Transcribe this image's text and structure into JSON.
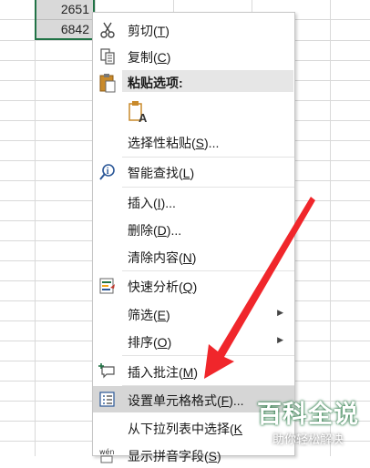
{
  "sheet": {
    "selected_cells": [
      "2651",
      "6842"
    ]
  },
  "menu": {
    "cut": {
      "text": "剪切(",
      "key": "T",
      "end": ")"
    },
    "copy": {
      "text": "复制(",
      "key": "C",
      "end": ")"
    },
    "paste_options_header": "粘贴选项:",
    "paste_special": {
      "text": "选择性粘贴(",
      "key": "S",
      "end": ")..."
    },
    "smart_lookup": {
      "text": "智能查找(",
      "key": "L",
      "end": ")"
    },
    "insert": {
      "text": "插入(",
      "key": "I",
      "end": ")..."
    },
    "delete": {
      "text": "删除(",
      "key": "D",
      "end": ")..."
    },
    "clear_contents": {
      "text": "清除内容(",
      "key": "N",
      "end": ")"
    },
    "quick_analysis": {
      "text": "快速分析(",
      "key": "Q",
      "end": ")"
    },
    "filter": {
      "text": "筛选(",
      "key": "E",
      "end": ")"
    },
    "sort": {
      "text": "排序(",
      "key": "O",
      "end": ")"
    },
    "insert_comment": {
      "text": "插入批注(",
      "key": "M",
      "end": ")"
    },
    "format_cells": {
      "text": "设置单元格格式(",
      "key": "F",
      "end": ")..."
    },
    "dropdown_pick": {
      "text": "从下拉列表中选择(",
      "key": "K",
      "end": ""
    },
    "phonetic": {
      "text": "显示拼音字段(",
      "key": "S",
      "end": ")"
    },
    "phonetic_icon_text": "wén"
  },
  "watermark": {
    "main": "百科全说",
    "sub": "助你轻松解决"
  },
  "colors": {
    "accent_green": "#217346",
    "annotation_red": "#f0262b",
    "highlight": "#d6d6d6"
  }
}
